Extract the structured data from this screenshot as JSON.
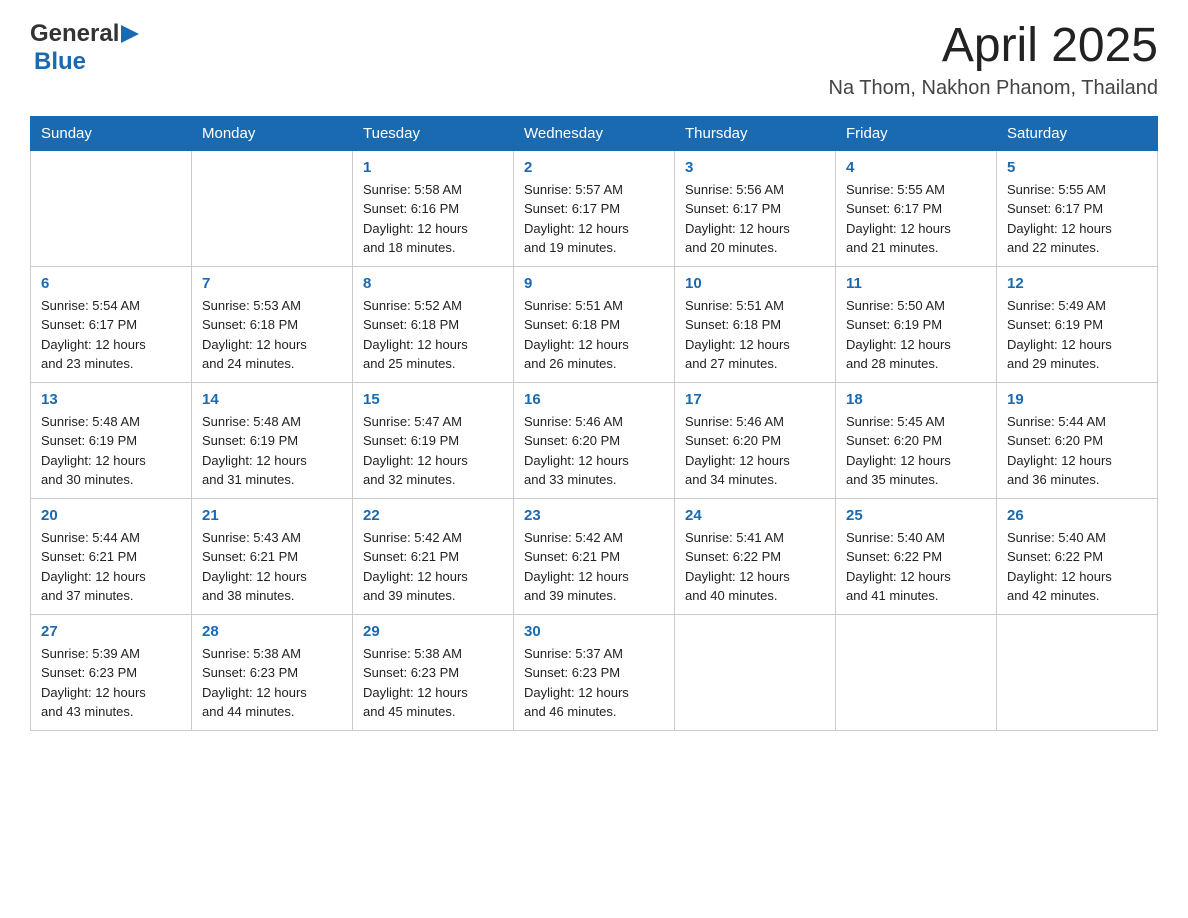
{
  "header": {
    "logo": {
      "general": "General",
      "blue": "Blue"
    },
    "title": "April 2025",
    "subtitle": "Na Thom, Nakhon Phanom, Thailand"
  },
  "columns": [
    "Sunday",
    "Monday",
    "Tuesday",
    "Wednesday",
    "Thursday",
    "Friday",
    "Saturday"
  ],
  "weeks": [
    [
      {
        "day": "",
        "info": ""
      },
      {
        "day": "",
        "info": ""
      },
      {
        "day": "1",
        "info": "Sunrise: 5:58 AM\nSunset: 6:16 PM\nDaylight: 12 hours\nand 18 minutes."
      },
      {
        "day": "2",
        "info": "Sunrise: 5:57 AM\nSunset: 6:17 PM\nDaylight: 12 hours\nand 19 minutes."
      },
      {
        "day": "3",
        "info": "Sunrise: 5:56 AM\nSunset: 6:17 PM\nDaylight: 12 hours\nand 20 minutes."
      },
      {
        "day": "4",
        "info": "Sunrise: 5:55 AM\nSunset: 6:17 PM\nDaylight: 12 hours\nand 21 minutes."
      },
      {
        "day": "5",
        "info": "Sunrise: 5:55 AM\nSunset: 6:17 PM\nDaylight: 12 hours\nand 22 minutes."
      }
    ],
    [
      {
        "day": "6",
        "info": "Sunrise: 5:54 AM\nSunset: 6:17 PM\nDaylight: 12 hours\nand 23 minutes."
      },
      {
        "day": "7",
        "info": "Sunrise: 5:53 AM\nSunset: 6:18 PM\nDaylight: 12 hours\nand 24 minutes."
      },
      {
        "day": "8",
        "info": "Sunrise: 5:52 AM\nSunset: 6:18 PM\nDaylight: 12 hours\nand 25 minutes."
      },
      {
        "day": "9",
        "info": "Sunrise: 5:51 AM\nSunset: 6:18 PM\nDaylight: 12 hours\nand 26 minutes."
      },
      {
        "day": "10",
        "info": "Sunrise: 5:51 AM\nSunset: 6:18 PM\nDaylight: 12 hours\nand 27 minutes."
      },
      {
        "day": "11",
        "info": "Sunrise: 5:50 AM\nSunset: 6:19 PM\nDaylight: 12 hours\nand 28 minutes."
      },
      {
        "day": "12",
        "info": "Sunrise: 5:49 AM\nSunset: 6:19 PM\nDaylight: 12 hours\nand 29 minutes."
      }
    ],
    [
      {
        "day": "13",
        "info": "Sunrise: 5:48 AM\nSunset: 6:19 PM\nDaylight: 12 hours\nand 30 minutes."
      },
      {
        "day": "14",
        "info": "Sunrise: 5:48 AM\nSunset: 6:19 PM\nDaylight: 12 hours\nand 31 minutes."
      },
      {
        "day": "15",
        "info": "Sunrise: 5:47 AM\nSunset: 6:19 PM\nDaylight: 12 hours\nand 32 minutes."
      },
      {
        "day": "16",
        "info": "Sunrise: 5:46 AM\nSunset: 6:20 PM\nDaylight: 12 hours\nand 33 minutes."
      },
      {
        "day": "17",
        "info": "Sunrise: 5:46 AM\nSunset: 6:20 PM\nDaylight: 12 hours\nand 34 minutes."
      },
      {
        "day": "18",
        "info": "Sunrise: 5:45 AM\nSunset: 6:20 PM\nDaylight: 12 hours\nand 35 minutes."
      },
      {
        "day": "19",
        "info": "Sunrise: 5:44 AM\nSunset: 6:20 PM\nDaylight: 12 hours\nand 36 minutes."
      }
    ],
    [
      {
        "day": "20",
        "info": "Sunrise: 5:44 AM\nSunset: 6:21 PM\nDaylight: 12 hours\nand 37 minutes."
      },
      {
        "day": "21",
        "info": "Sunrise: 5:43 AM\nSunset: 6:21 PM\nDaylight: 12 hours\nand 38 minutes."
      },
      {
        "day": "22",
        "info": "Sunrise: 5:42 AM\nSunset: 6:21 PM\nDaylight: 12 hours\nand 39 minutes."
      },
      {
        "day": "23",
        "info": "Sunrise: 5:42 AM\nSunset: 6:21 PM\nDaylight: 12 hours\nand 39 minutes."
      },
      {
        "day": "24",
        "info": "Sunrise: 5:41 AM\nSunset: 6:22 PM\nDaylight: 12 hours\nand 40 minutes."
      },
      {
        "day": "25",
        "info": "Sunrise: 5:40 AM\nSunset: 6:22 PM\nDaylight: 12 hours\nand 41 minutes."
      },
      {
        "day": "26",
        "info": "Sunrise: 5:40 AM\nSunset: 6:22 PM\nDaylight: 12 hours\nand 42 minutes."
      }
    ],
    [
      {
        "day": "27",
        "info": "Sunrise: 5:39 AM\nSunset: 6:23 PM\nDaylight: 12 hours\nand 43 minutes."
      },
      {
        "day": "28",
        "info": "Sunrise: 5:38 AM\nSunset: 6:23 PM\nDaylight: 12 hours\nand 44 minutes."
      },
      {
        "day": "29",
        "info": "Sunrise: 5:38 AM\nSunset: 6:23 PM\nDaylight: 12 hours\nand 45 minutes."
      },
      {
        "day": "30",
        "info": "Sunrise: 5:37 AM\nSunset: 6:23 PM\nDaylight: 12 hours\nand 46 minutes."
      },
      {
        "day": "",
        "info": ""
      },
      {
        "day": "",
        "info": ""
      },
      {
        "day": "",
        "info": ""
      }
    ]
  ]
}
